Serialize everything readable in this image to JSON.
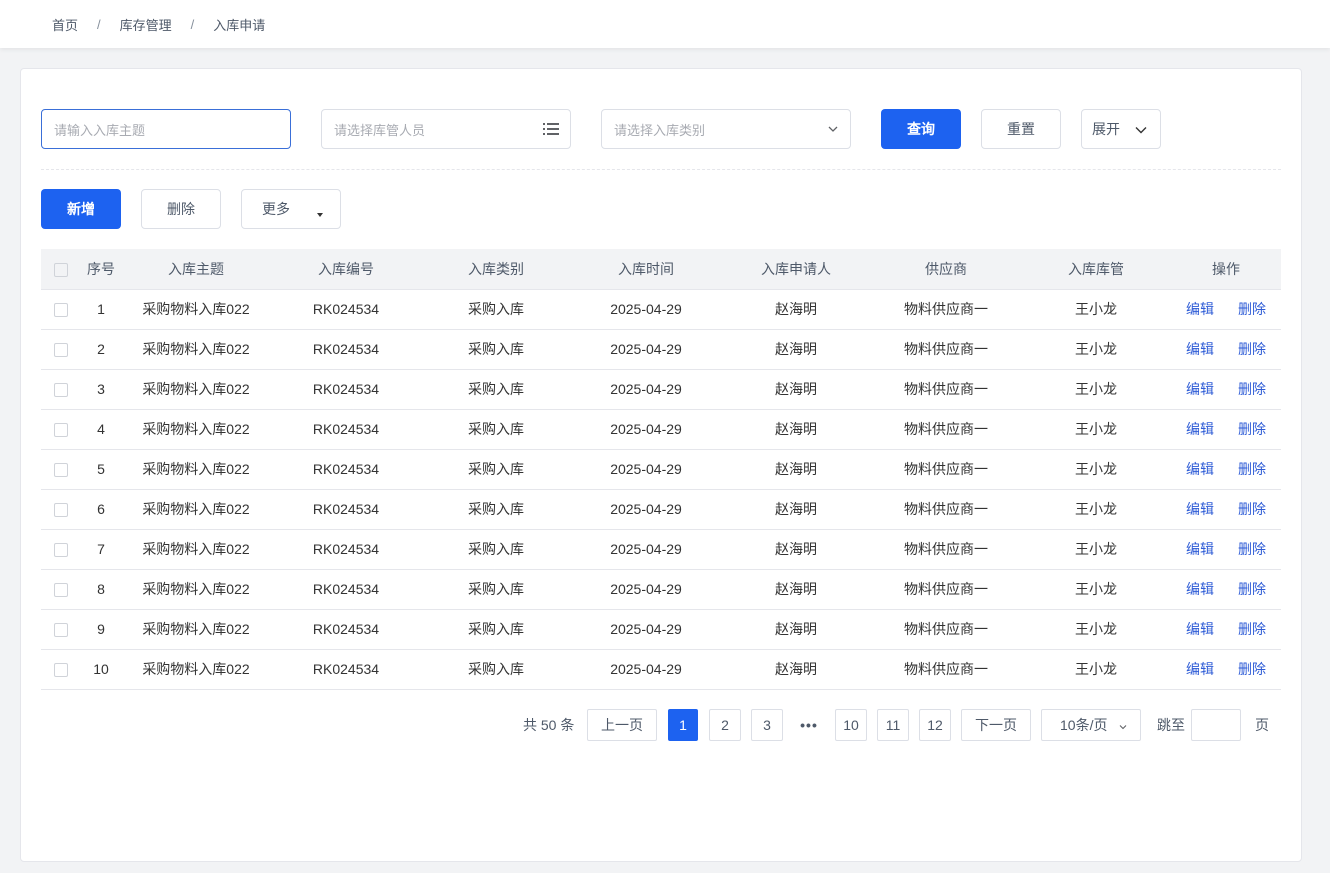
{
  "breadcrumb": [
    "首页",
    "库存管理",
    "入库申请"
  ],
  "breadcrumb_separator": "/",
  "search": {
    "subject_placeholder": "请输入入库主题",
    "manager_placeholder": "请选择库管人员",
    "category_placeholder": "请选择入库类别",
    "query_label": "查询",
    "reset_label": "重置",
    "expand_label": "展开"
  },
  "toolbar": {
    "add_label": "新增",
    "delete_label": "删除",
    "more_label": "更多"
  },
  "table": {
    "columns": [
      "序号",
      "入库主题",
      "入库编号",
      "入库类别",
      "入库时间",
      "入库申请人",
      "供应商",
      "入库库管",
      "操作"
    ],
    "edit_label": "编辑",
    "delete_label": "删除",
    "rows": [
      {
        "no": "1",
        "subject": "采购物料入库022",
        "code": "RK024534",
        "category": "采购入库",
        "time": "2025-04-29",
        "applicant": "赵海明",
        "supplier": "物料供应商一",
        "keeper": "王小龙"
      },
      {
        "no": "2",
        "subject": "采购物料入库022",
        "code": "RK024534",
        "category": "采购入库",
        "time": "2025-04-29",
        "applicant": "赵海明",
        "supplier": "物料供应商一",
        "keeper": "王小龙"
      },
      {
        "no": "3",
        "subject": "采购物料入库022",
        "code": "RK024534",
        "category": "采购入库",
        "time": "2025-04-29",
        "applicant": "赵海明",
        "supplier": "物料供应商一",
        "keeper": "王小龙"
      },
      {
        "no": "4",
        "subject": "采购物料入库022",
        "code": "RK024534",
        "category": "采购入库",
        "time": "2025-04-29",
        "applicant": "赵海明",
        "supplier": "物料供应商一",
        "keeper": "王小龙"
      },
      {
        "no": "5",
        "subject": "采购物料入库022",
        "code": "RK024534",
        "category": "采购入库",
        "time": "2025-04-29",
        "applicant": "赵海明",
        "supplier": "物料供应商一",
        "keeper": "王小龙"
      },
      {
        "no": "6",
        "subject": "采购物料入库022",
        "code": "RK024534",
        "category": "采购入库",
        "time": "2025-04-29",
        "applicant": "赵海明",
        "supplier": "物料供应商一",
        "keeper": "王小龙"
      },
      {
        "no": "7",
        "subject": "采购物料入库022",
        "code": "RK024534",
        "category": "采购入库",
        "time": "2025-04-29",
        "applicant": "赵海明",
        "supplier": "物料供应商一",
        "keeper": "王小龙"
      },
      {
        "no": "8",
        "subject": "采购物料入库022",
        "code": "RK024534",
        "category": "采购入库",
        "time": "2025-04-29",
        "applicant": "赵海明",
        "supplier": "物料供应商一",
        "keeper": "王小龙"
      },
      {
        "no": "9",
        "subject": "采购物料入库022",
        "code": "RK024534",
        "category": "采购入库",
        "time": "2025-04-29",
        "applicant": "赵海明",
        "supplier": "物料供应商一",
        "keeper": "王小龙"
      },
      {
        "no": "10",
        "subject": "采购物料入库022",
        "code": "RK024534",
        "category": "采购入库",
        "time": "2025-04-29",
        "applicant": "赵海明",
        "supplier": "物料供应商一",
        "keeper": "王小龙"
      }
    ]
  },
  "pagination": {
    "total_text": "共 50 条",
    "prev_label": "上一页",
    "next_label": "下一页",
    "pages": [
      "1",
      "2",
      "3",
      "10",
      "11",
      "12"
    ],
    "current": "1",
    "ellipsis": "•••",
    "page_size": "10条/页",
    "jump_label": "跳至",
    "jump_suffix": "页"
  },
  "colors": {
    "primary": "#1d62f0",
    "link": "#2d5bd6",
    "header_bg": "#f2f3f5"
  }
}
